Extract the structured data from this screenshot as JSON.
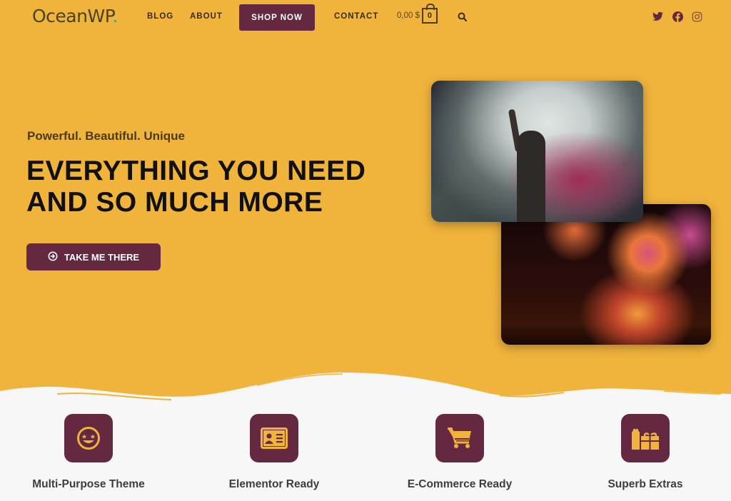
{
  "brand": {
    "logo_text": "OceanWP",
    "logo_dot": ".",
    "colors": {
      "primary": "#f0b33c",
      "accent": "#652841",
      "text_dark": "#111111"
    }
  },
  "nav": {
    "items": [
      {
        "label": "BLOG"
      },
      {
        "label": "ABOUT"
      },
      {
        "label": "SHOP NOW"
      },
      {
        "label": "CONTACT"
      }
    ],
    "cart": {
      "total": "0,00 $",
      "count": "0",
      "icon": "shopping-bag-icon"
    },
    "search_icon": "search-icon",
    "social": [
      {
        "name": "twitter",
        "icon": "twitter-icon"
      },
      {
        "name": "facebook",
        "icon": "facebook-icon"
      },
      {
        "name": "instagram",
        "icon": "instagram-icon"
      }
    ]
  },
  "hero": {
    "tagline": "Powerful. Beautiful. Unique",
    "headline_bold": "EVERYTHING YOU NEED",
    "headline_light": "AND SO MUCH MORE",
    "cta_label": "TAKE ME THERE",
    "cta_icon": "arrow-circle-right-icon",
    "images": [
      {
        "alt": "Performer with raised hand in colored smoke"
      },
      {
        "alt": "Fireworks over water at night"
      }
    ]
  },
  "features": [
    {
      "label": "Multi-Purpose Theme",
      "icon": "star-struck-face-icon"
    },
    {
      "label": "Elementor Ready",
      "icon": "id-card-icon"
    },
    {
      "label": "E-Commerce Ready",
      "icon": "shopping-cart-icon"
    },
    {
      "label": "Superb Extras",
      "icon": "gifts-icon"
    }
  ]
}
